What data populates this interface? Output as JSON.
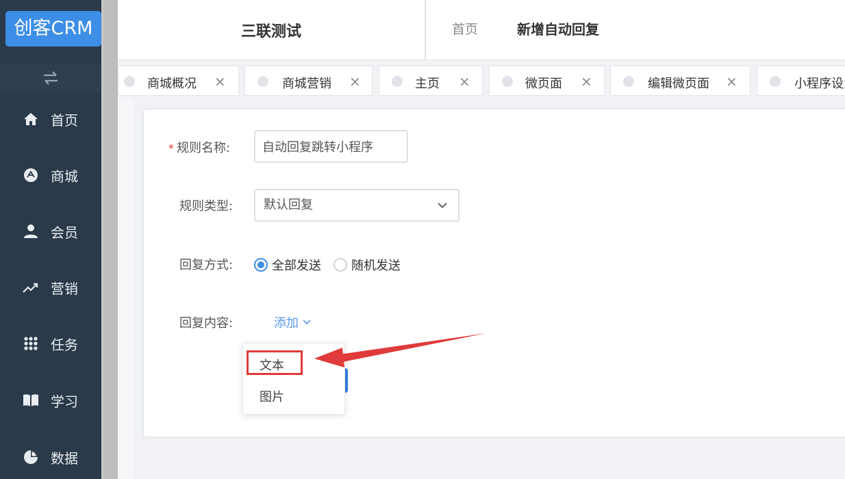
{
  "sidebar": {
    "logo": "创客CRM",
    "items": [
      {
        "label": "首页",
        "icon": "home-icon"
      },
      {
        "label": "商城",
        "icon": "store-icon"
      },
      {
        "label": "会员",
        "icon": "user-icon"
      },
      {
        "label": "营销",
        "icon": "trend-icon"
      },
      {
        "label": "任务",
        "icon": "grid-icon"
      },
      {
        "label": "学习",
        "icon": "book-icon"
      },
      {
        "label": "数据",
        "icon": "pie-icon"
      }
    ]
  },
  "header": {
    "store_name": "三联测试",
    "breadcrumb_home": "首页",
    "breadcrumb_current": "新增自动回复"
  },
  "tabs": [
    "商城概况",
    "商城营销",
    "主页",
    "微页面",
    "编辑微页面",
    "小程序设置"
  ],
  "form": {
    "rule_name_label": "规则名称:",
    "rule_name_value": "自动回复跳转小程序",
    "rule_type_label": "规则类型:",
    "rule_type_value": "默认回复",
    "reply_mode_label": "回复方式:",
    "reply_mode_options": [
      "全部发送",
      "随机发送"
    ],
    "reply_mode_selected": "全部发送",
    "reply_content_label": "回复内容:",
    "add_label": "添加"
  },
  "dropdown": {
    "items": [
      "文本",
      "图片"
    ],
    "highlighted": "文本"
  },
  "colors": {
    "sidebar_bg": "#2b3a4a",
    "accent": "#3d8ee6",
    "annotation_red": "#e03a3a"
  }
}
